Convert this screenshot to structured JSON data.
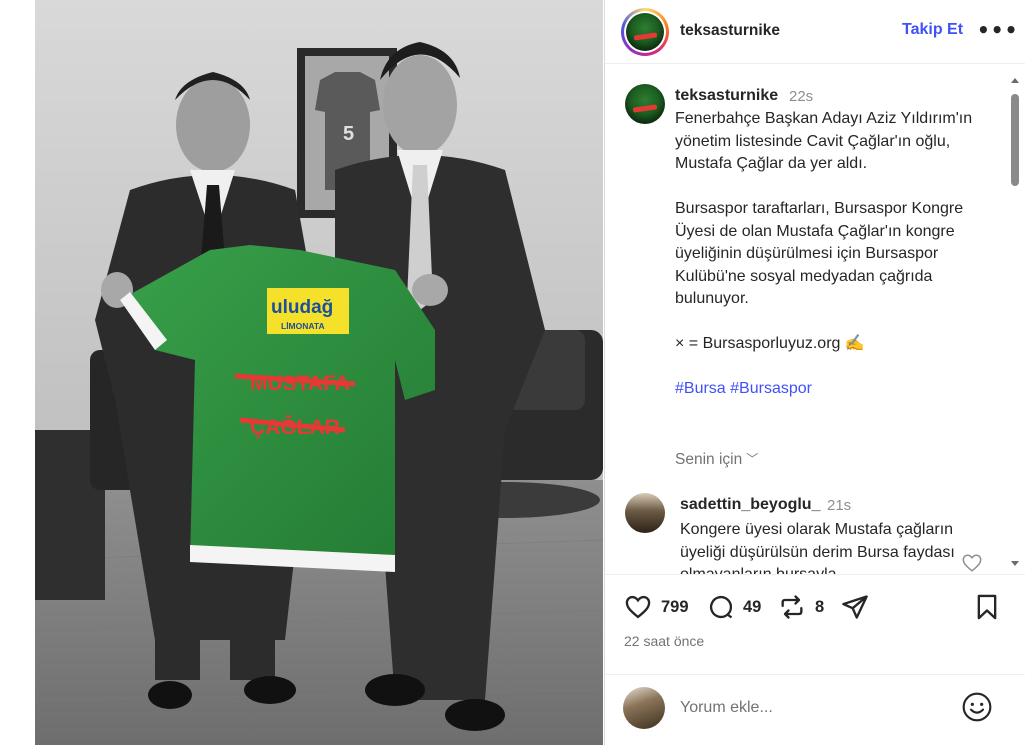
{
  "post": {
    "username": "teksasturnike",
    "follow_label": "Takip Et",
    "more_label": "•••"
  },
  "photo": {
    "jersey_sponsor_line1": "uludağ",
    "jersey_sponsor_line2": "LİMONATA",
    "jersey_name_line1": "MUSTAFA",
    "jersey_name_line2": "ÇAĞLAR",
    "frame_number": "5"
  },
  "caption": {
    "username": "teksasturnike",
    "time": "22s",
    "paragraphs": [
      "Fenerbahçe Başkan Adayı Aziz Yıldırım'ın yönetim listesinde Cavit Çağlar'ın oğlu, Mustafa Çağlar da yer aldı.",
      "Bursaspor taraftarları, Bursaspor Kongre Üyesi de olan Mustafa Çağlar'ın kongre üyeliğinin düşürülmesi için Bursaspor Kulübü'ne sosyal medyadan çağrıda bulunuyor.",
      "× = Bursasporluyuz.org ✍️"
    ],
    "hashtags": "#Bursa #Bursaspor",
    "translate_label": "Senin için"
  },
  "comment": {
    "username": "sadettin_beyoglu_",
    "time": "21s",
    "text": "Kongere üyesi olarak Mustafa çağların üyeliği düşürülsün derim Bursa faydası olmayanların bursayla"
  },
  "actions": {
    "likes": "799",
    "comments": "49",
    "reposts": "8",
    "posted_ago": "22 saat önce"
  },
  "comment_box": {
    "placeholder": "Yorum ekle..."
  },
  "colors": {
    "accent_blue": "#4150f7",
    "jersey_green": "#2e8b3e",
    "strike_red": "#e53935"
  }
}
